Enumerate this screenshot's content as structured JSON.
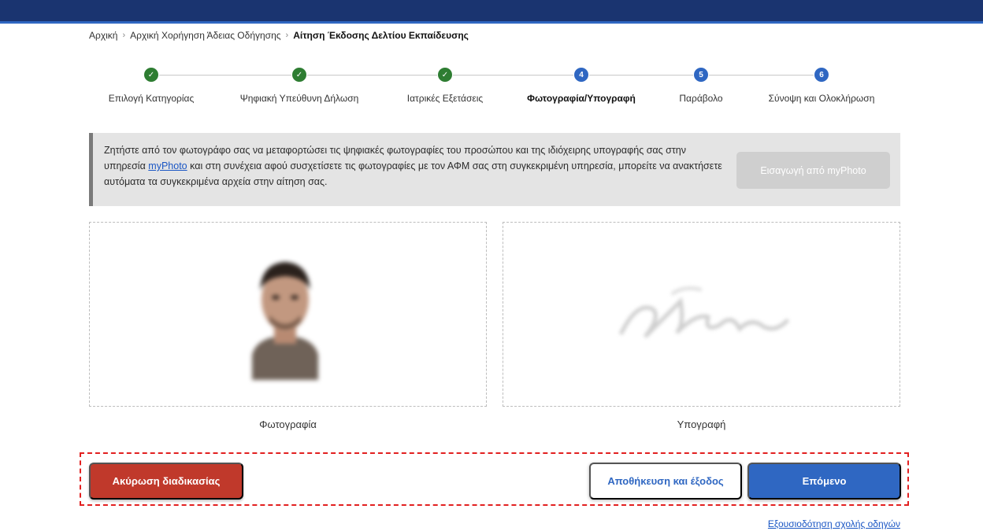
{
  "breadcrumb": {
    "items": [
      "Αρχική",
      "Αρχική Χορήγηση Άδειας Οδήγησης"
    ],
    "current": "Αίτηση Έκδοσης Δελτίου Εκπαίδευσης",
    "separator": "›"
  },
  "stepper": {
    "steps": [
      {
        "label": "Επιλογή Κατηγορίας",
        "state": "done",
        "number": "✓"
      },
      {
        "label": "Ψηφιακή Υπεύθυνη Δήλωση",
        "state": "done",
        "number": "✓"
      },
      {
        "label": "Ιατρικές Εξετάσεις",
        "state": "done",
        "number": "✓"
      },
      {
        "label": "Φωτογραφία/Υπογραφή",
        "state": "active",
        "number": "4"
      },
      {
        "label": "Παράβολο",
        "state": "todo",
        "number": "5"
      },
      {
        "label": "Σύνοψη και Ολοκλήρωση",
        "state": "todo",
        "number": "6"
      }
    ]
  },
  "info": {
    "text_before_link": "Ζητήστε από τον φωτογράφο σας να μεταφορτώσει τις ψηφιακές φωτογραφίες του προσώπου και της ιδιόχειρης υπογραφής σας στην υπηρεσία ",
    "link": "myPhoto",
    "text_after_link": " και στη συνέχεια αφού συσχετίσετε τις φωτογραφίες με τον ΑΦΜ σας στη συγκεκριμένη υπηρεσία, μπορείτε να ανακτήσετε αυτόματα τα συγκεκριμένα αρχεία στην αίτηση σας.",
    "import_button": "Εισαγωγή από myPhoto"
  },
  "uploads": {
    "photo_caption": "Φωτογραφία",
    "signature_caption": "Υπογραφή"
  },
  "actions": {
    "cancel": "Ακύρωση διαδικασίας",
    "save_exit": "Αποθήκευση και έξοδος",
    "next": "Επόμενο"
  },
  "footer": {
    "link": "Εξουσιοδότηση σχολής οδηγών"
  },
  "colors": {
    "primary": "#2f67c2",
    "done": "#2e7d32",
    "danger": "#c0392b",
    "header": "#1a3470"
  }
}
